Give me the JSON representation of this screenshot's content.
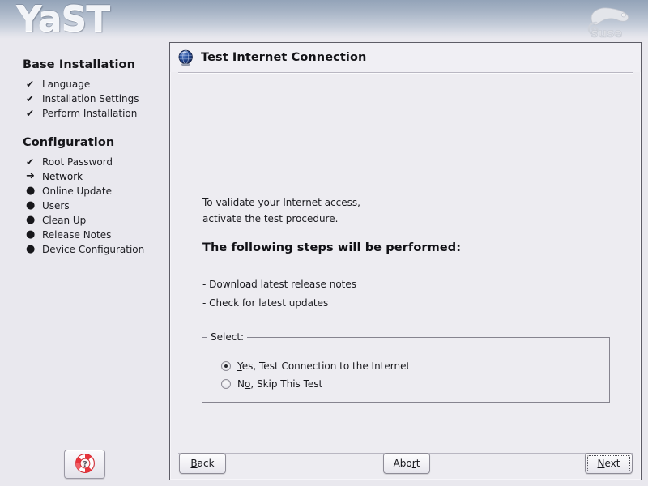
{
  "app": {
    "logo_text": "YaST",
    "brand_logo": "suse-chameleon-logo",
    "brand_text": "suse"
  },
  "sidebar": {
    "sections": [
      {
        "heading": "Base Installation",
        "items": [
          {
            "label": "Language",
            "marker": "check",
            "glyph": "✔"
          },
          {
            "label": "Installation Settings",
            "marker": "check",
            "glyph": "✔"
          },
          {
            "label": "Perform Installation",
            "marker": "check",
            "glyph": "✔"
          }
        ]
      },
      {
        "heading": "Configuration",
        "items": [
          {
            "label": "Root Password",
            "marker": "check",
            "glyph": "✔"
          },
          {
            "label": "Network",
            "marker": "current",
            "glyph": "➜"
          },
          {
            "label": "Online Update",
            "marker": "pending",
            "glyph": "●"
          },
          {
            "label": "Users",
            "marker": "pending",
            "glyph": "●"
          },
          {
            "label": "Clean Up",
            "marker": "pending",
            "glyph": "●"
          },
          {
            "label": "Release Notes",
            "marker": "pending",
            "glyph": "●"
          },
          {
            "label": "Device Configuration",
            "marker": "pending",
            "glyph": "●"
          }
        ]
      }
    ],
    "help_button": {
      "icon": "life-ring-help-icon",
      "symbol": "?"
    }
  },
  "dialog": {
    "icon": "globe-internet-icon",
    "title": "Test Internet Connection",
    "intro_line1": "To validate your Internet access,",
    "intro_line2": "activate the test procedure.",
    "steps_heading": "The following steps will be performed:",
    "steps": [
      "- Download latest release notes",
      "- Check for latest updates"
    ],
    "select_group": {
      "legend": "Select:",
      "options": [
        {
          "prefix": "",
          "mnemonic": "Y",
          "suffix": "es, Test Connection to the Internet",
          "selected": true
        },
        {
          "prefix": "N",
          "mnemonic": "o",
          "suffix": ", Skip This Test",
          "selected": false
        }
      ]
    },
    "buttons": {
      "back": {
        "prefix": "",
        "mnemonic": "B",
        "suffix": "ack",
        "focused": false
      },
      "abort": {
        "prefix": "Abo",
        "mnemonic": "r",
        "suffix": "t",
        "focused": false
      },
      "next": {
        "prefix": "",
        "mnemonic": "N",
        "suffix": "ext",
        "focused": true
      }
    }
  },
  "colors": {
    "banner_top": "#93a3b8",
    "body_bg": "#e9e8ee",
    "dialog_bg": "#edecf1",
    "dialog_border": "#5d5c66",
    "text": "#1b1b20",
    "help_icon_red": "#e8343c"
  }
}
